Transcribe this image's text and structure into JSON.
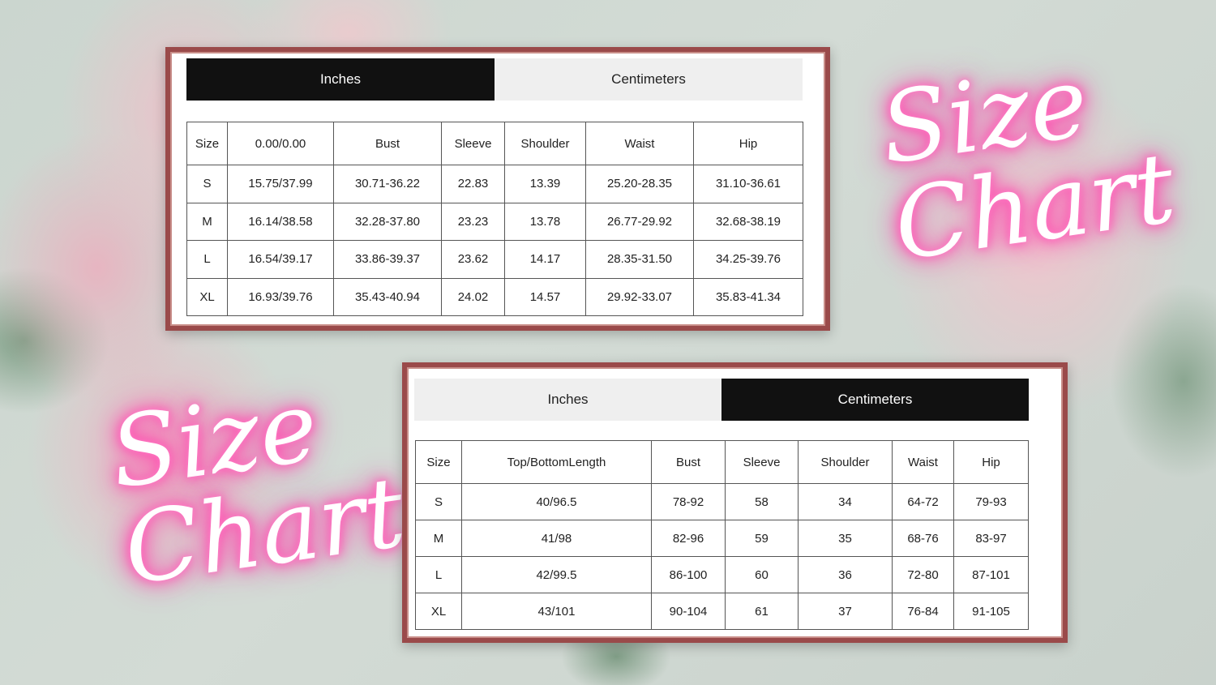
{
  "decor": {
    "neon_top": {
      "line1": "Size",
      "line2": "Chart"
    },
    "neon_bottom": {
      "line1": "Size",
      "line2": "Chart"
    }
  },
  "inches_panel": {
    "tabs": {
      "inches": "Inches",
      "centimeters": "Centimeters",
      "active": "Inches"
    },
    "headers": [
      "Size",
      "0.00/0.00",
      "Bust",
      "Sleeve",
      "Shoulder",
      "Waist",
      "Hip"
    ],
    "rows": [
      [
        "S",
        "15.75/37.99",
        "30.71-36.22",
        "22.83",
        "13.39",
        "25.20-28.35",
        "31.10-36.61"
      ],
      [
        "M",
        "16.14/38.58",
        "32.28-37.80",
        "23.23",
        "13.78",
        "26.77-29.92",
        "32.68-38.19"
      ],
      [
        "L",
        "16.54/39.17",
        "33.86-39.37",
        "23.62",
        "14.17",
        "28.35-31.50",
        "34.25-39.76"
      ],
      [
        "XL",
        "16.93/39.76",
        "35.43-40.94",
        "24.02",
        "14.57",
        "29.92-33.07",
        "35.83-41.34"
      ]
    ]
  },
  "cm_panel": {
    "tabs": {
      "inches": "Inches",
      "centimeters": "Centimeters",
      "active": "Centimeters"
    },
    "headers": [
      "Size",
      "Top/BottomLength",
      "Bust",
      "Sleeve",
      "Shoulder",
      "Waist",
      "Hip"
    ],
    "rows": [
      [
        "S",
        "40/96.5",
        "78-92",
        "58",
        "34",
        "64-72",
        "79-93"
      ],
      [
        "M",
        "41/98",
        "82-96",
        "59",
        "35",
        "68-76",
        "83-97"
      ],
      [
        "L",
        "42/99.5",
        "86-100",
        "60",
        "36",
        "72-80",
        "87-101"
      ],
      [
        "XL",
        "43/101",
        "90-104",
        "61",
        "37",
        "76-84",
        "91-105"
      ]
    ]
  }
}
